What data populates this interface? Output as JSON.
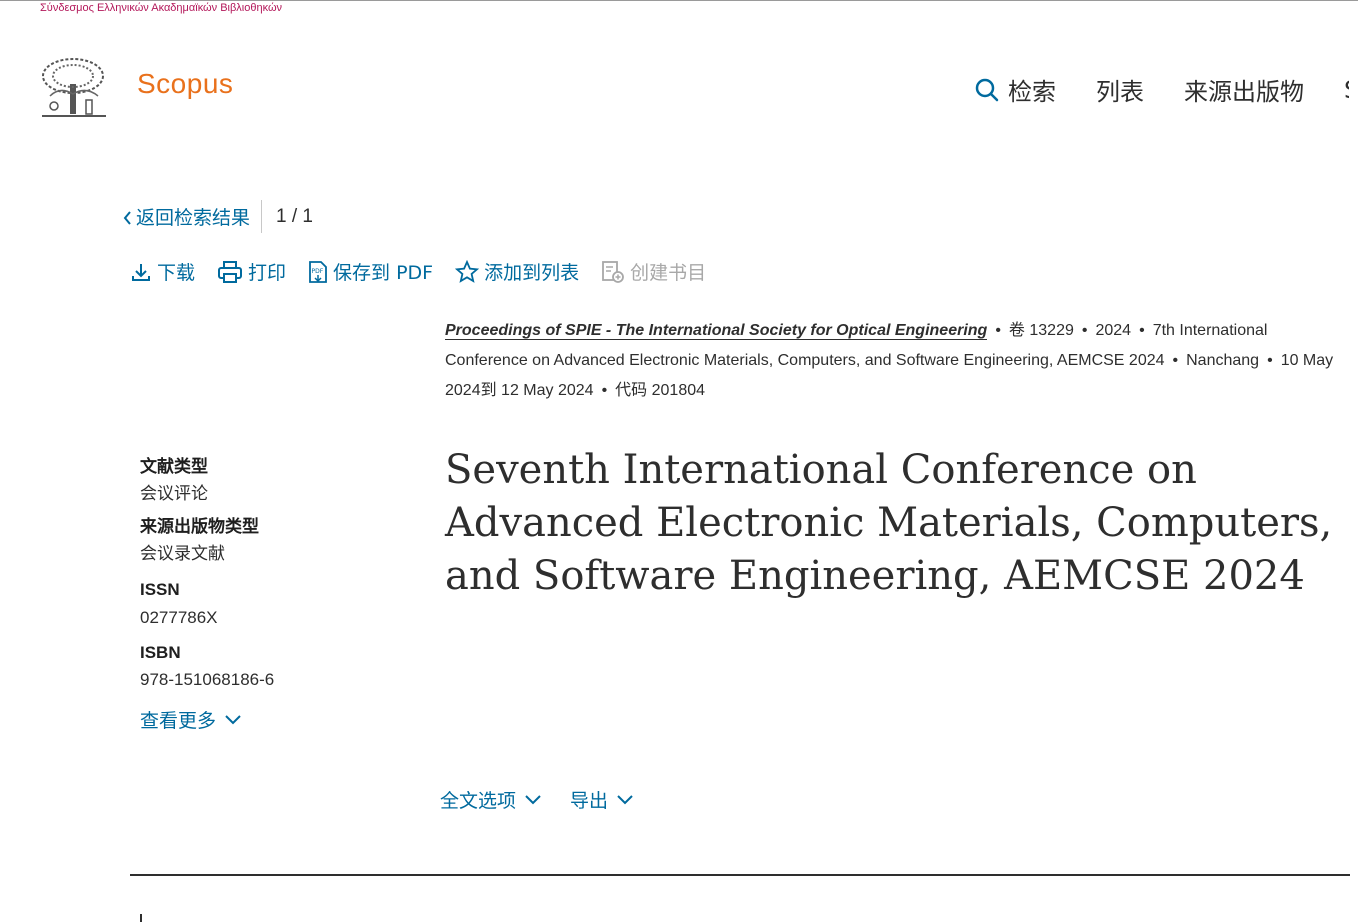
{
  "banner": {
    "text": "Σύνδεσμος Ελληνικών Ακαδημαϊκών Βιβλιοθηκών"
  },
  "header": {
    "brand": "Scopus",
    "nav": [
      {
        "label": "检索",
        "icon": "search-icon"
      },
      {
        "label": "列表"
      },
      {
        "label": "来源出版物"
      }
    ],
    "nav_clipped": "S"
  },
  "backrow": {
    "back_label": "返回检索结果",
    "pager": "1 / 1"
  },
  "toolbar": {
    "download": "下载",
    "print": "打印",
    "save_pdf": "保存到 PDF",
    "add_to_list": "添加到列表",
    "create_bibliography": "创建书目"
  },
  "source": {
    "journal": "Proceedings of SPIE - The International Society for Optical Engineering",
    "volume": "卷 13229",
    "year": "2024",
    "conference_line1": "7th International",
    "conference_line2": "Conference on Advanced Electronic Materials, Computers, and Software Engineering, AEMCSE 2024",
    "location": "Nanchang",
    "dates_start": "10 May",
    "dates_end": "2024到 12 May 2024",
    "code": "代码 201804"
  },
  "meta": {
    "doc_type_label": "文献类型",
    "doc_type_value": "会议评论",
    "source_type_label": "来源出版物类型",
    "source_type_value": "会议录文献",
    "issn_label": "ISSN",
    "issn_value": "0277786X",
    "isbn_label": "ISBN",
    "isbn_value": "978-151068186-6",
    "more_label": "查看更多"
  },
  "title": "Seventh International Conference on Advanced Electronic Materials, Computers, and Software Engineering, AEMCSE 2024",
  "actions": {
    "full_text": "全文选项",
    "export": "导出"
  },
  "colors": {
    "brand": "#e9711c",
    "link": "#006a9e",
    "text": "#2e2e2e",
    "disabled": "#a8a8a8"
  }
}
